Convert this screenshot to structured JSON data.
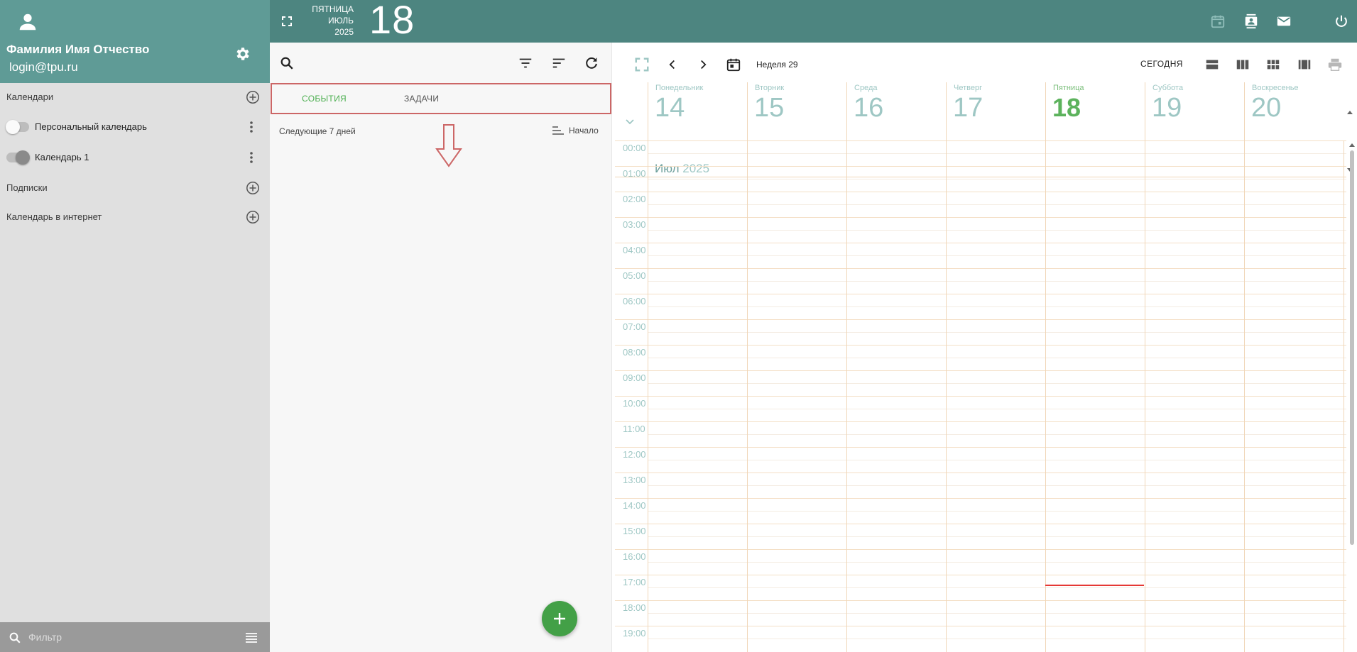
{
  "profile": {
    "name": "Фамилия Имя Отчество",
    "login": "login@tpu.ru"
  },
  "sidebar": {
    "sections": [
      {
        "label": "Календари"
      },
      {
        "label": "Подписки"
      },
      {
        "label": "Календарь в интернет"
      }
    ],
    "calendars": [
      {
        "label": "Персональный календарь",
        "enabled": false
      },
      {
        "label": "Календарь 1",
        "enabled": true
      }
    ],
    "filter_placeholder": "Фильтр"
  },
  "header": {
    "weekday": "ПЯТНИЦА",
    "month": "ИЮЛЬ",
    "year": "2025",
    "day": "18",
    "icons": [
      "fullscreen-icon",
      "calendar-icon",
      "contacts-icon",
      "mail-icon",
      "power-icon"
    ]
  },
  "events_panel": {
    "tabs": [
      {
        "label": "СОБЫТИЯ",
        "active": true
      },
      {
        "label": "ЗАДАЧИ",
        "active": false
      }
    ],
    "range_label": "Следующие 7 дней",
    "sort_label": "Начало",
    "tool_icons": [
      "search-icon",
      "filter-icon",
      "sort-icon",
      "refresh-icon"
    ],
    "add_button_icon": "plus-icon"
  },
  "calendar": {
    "week_label": "Неделя 29",
    "today_label": "СЕГОДНЯ",
    "month": "Июл",
    "year": "2025",
    "days": [
      {
        "name": "Понедельник",
        "num": "14"
      },
      {
        "name": "Вторник",
        "num": "15"
      },
      {
        "name": "Среда",
        "num": "16"
      },
      {
        "name": "Четверг",
        "num": "17"
      },
      {
        "name": "Пятница",
        "num": "18",
        "today": true
      },
      {
        "name": "Суббота",
        "num": "19"
      },
      {
        "name": "Воскресенье",
        "num": "20"
      }
    ],
    "hours": [
      "00:00",
      "01:00",
      "02:00",
      "03:00",
      "04:00",
      "05:00",
      "06:00",
      "07:00",
      "08:00",
      "09:00",
      "10:00",
      "11:00",
      "12:00",
      "13:00",
      "14:00",
      "15:00",
      "16:00",
      "17:00",
      "18:00",
      "19:00"
    ],
    "current_time_hours": 17.4,
    "view_icons": [
      "view-day-icon",
      "view-week-icon",
      "view-month-icon",
      "view-list-icon",
      "print-icon"
    ]
  },
  "colors": {
    "profile_bg": "#5f9b96",
    "header_bg": "#4d8580",
    "accent_green": "#4caf50",
    "today_green": "#5cb25c",
    "grid_line": "#f0d6b8",
    "now_line": "#e53935",
    "highlight_border": "#cc6666"
  }
}
